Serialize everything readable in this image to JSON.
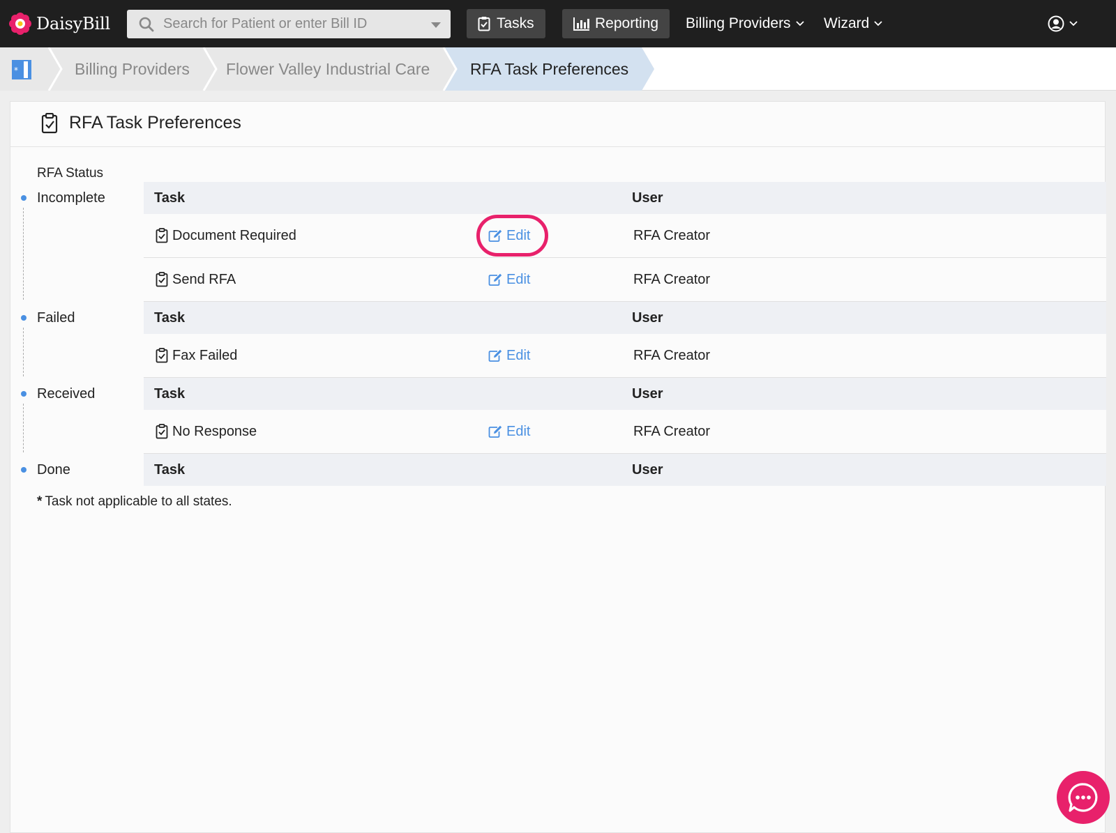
{
  "app": {
    "name": "DaisyBill"
  },
  "search": {
    "placeholder": "Search for Patient or enter Bill ID"
  },
  "nav": {
    "tasks_label": "Tasks",
    "reporting_label": "Reporting",
    "billing_providers_label": "Billing Providers",
    "wizard_label": "Wizard"
  },
  "breadcrumb": {
    "items": [
      "Billing Providers",
      "Flower Valley Industrial Care",
      "RFA Task Preferences"
    ]
  },
  "page": {
    "title": "RFA Task Preferences"
  },
  "rfa": {
    "status_label": "RFA Status",
    "task_header": "Task",
    "user_header": "User",
    "edit_label": "Edit",
    "states": [
      {
        "name": "Incomplete",
        "tasks": [
          {
            "name": "Document Required",
            "user": "RFA Creator"
          },
          {
            "name": "Send RFA",
            "user": "RFA Creator"
          }
        ]
      },
      {
        "name": "Failed",
        "tasks": [
          {
            "name": "Fax Failed",
            "user": "RFA Creator"
          }
        ]
      },
      {
        "name": "Received",
        "tasks": [
          {
            "name": "No Response",
            "user": "RFA Creator"
          }
        ]
      },
      {
        "name": "Done",
        "tasks": []
      }
    ],
    "footnote_star": "*",
    "footnote": "Task not applicable to all states."
  },
  "colors": {
    "accent": "#4a90e2",
    "highlight": "#e8216b",
    "nav_bg": "#1f1f1f"
  },
  "icons": {
    "logo": "daisy-flower-icon",
    "search": "search-icon",
    "tasks": "clipboard-check-icon",
    "reporting": "bar-chart-icon",
    "user": "user-circle-icon",
    "chat": "chat-bubble-icon",
    "edit": "edit-pencil-icon"
  }
}
